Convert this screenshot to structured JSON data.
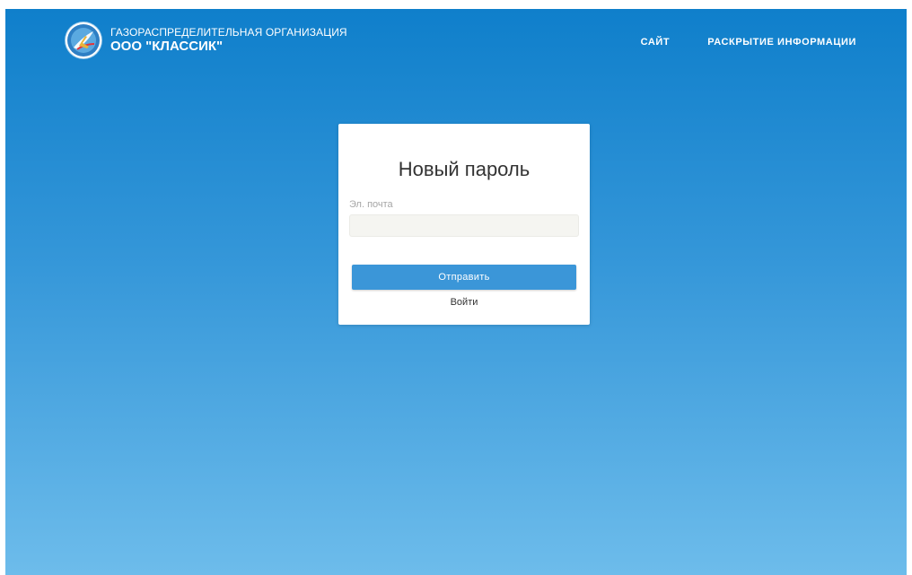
{
  "header": {
    "logo": {
      "icon": "company-logo-emblem",
      "text": "ООО КЛАССИК"
    },
    "brand_line1": "ГАЗОРАСПРЕДЕЛИТЕЛЬНАЯ ОРГАНИЗАЦИЯ",
    "brand_line2": "ООО \"КЛАССИК\""
  },
  "nav": {
    "site_label": "САЙТ",
    "disclosure_label": "РАСКРЫТИЕ ИНФОРМАЦИИ"
  },
  "form": {
    "title": "Новый пароль",
    "email_label": "Эл. почта",
    "email_value": "",
    "submit_label": "Отправить",
    "login_label": "Войти"
  },
  "colors": {
    "gradient_top": "#0f7fcb",
    "gradient_bottom": "#6dbceb",
    "button": "#3b96d8",
    "card": "#ffffff"
  }
}
